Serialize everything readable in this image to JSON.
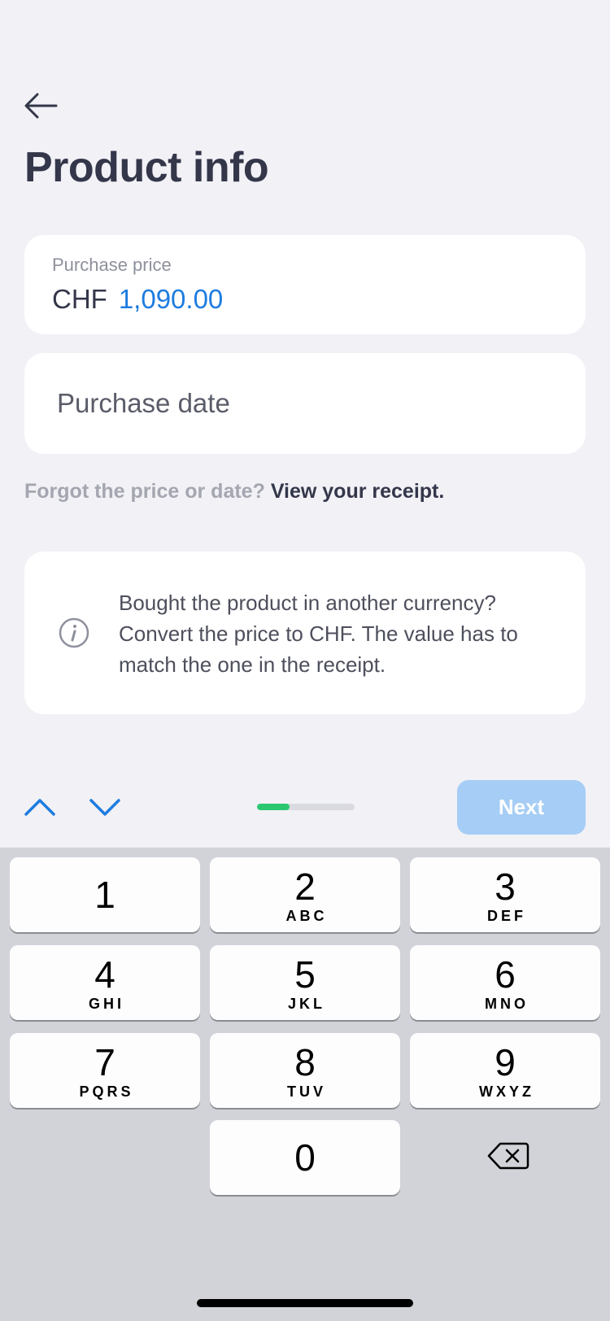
{
  "header": {
    "back_icon": "arrow-left-icon",
    "title": "Product info"
  },
  "price_field": {
    "label": "Purchase price",
    "currency": "CHF",
    "value": "1,090.00"
  },
  "date_field": {
    "placeholder": "Purchase date"
  },
  "receipt_hint": {
    "question": "Forgot the price or date?",
    "link": "View your receipt."
  },
  "info_box": {
    "icon": "info-icon",
    "text": "Bought the product in another currency? Convert the price to CHF. The value has to match the one in the receipt."
  },
  "toolbar": {
    "prev_icon": "chevron-up-icon",
    "next_field_icon": "chevron-down-icon",
    "progress_fraction": 0.33,
    "next_label": "Next"
  },
  "keypad": {
    "keys": [
      {
        "digit": "1",
        "letters": ""
      },
      {
        "digit": "2",
        "letters": "ABC"
      },
      {
        "digit": "3",
        "letters": "DEF"
      },
      {
        "digit": "4",
        "letters": "GHI"
      },
      {
        "digit": "5",
        "letters": "JKL"
      },
      {
        "digit": "6",
        "letters": "MNO"
      },
      {
        "digit": "7",
        "letters": "PQRS"
      },
      {
        "digit": "8",
        "letters": "TUV"
      },
      {
        "digit": "9",
        "letters": "WXYZ"
      },
      {
        "digit": "0",
        "letters": ""
      }
    ],
    "delete_icon": "backspace-icon"
  },
  "colors": {
    "accent": "#1d7ce0",
    "next_disabled": "#a6cdf5",
    "progress": "#2ac770"
  }
}
